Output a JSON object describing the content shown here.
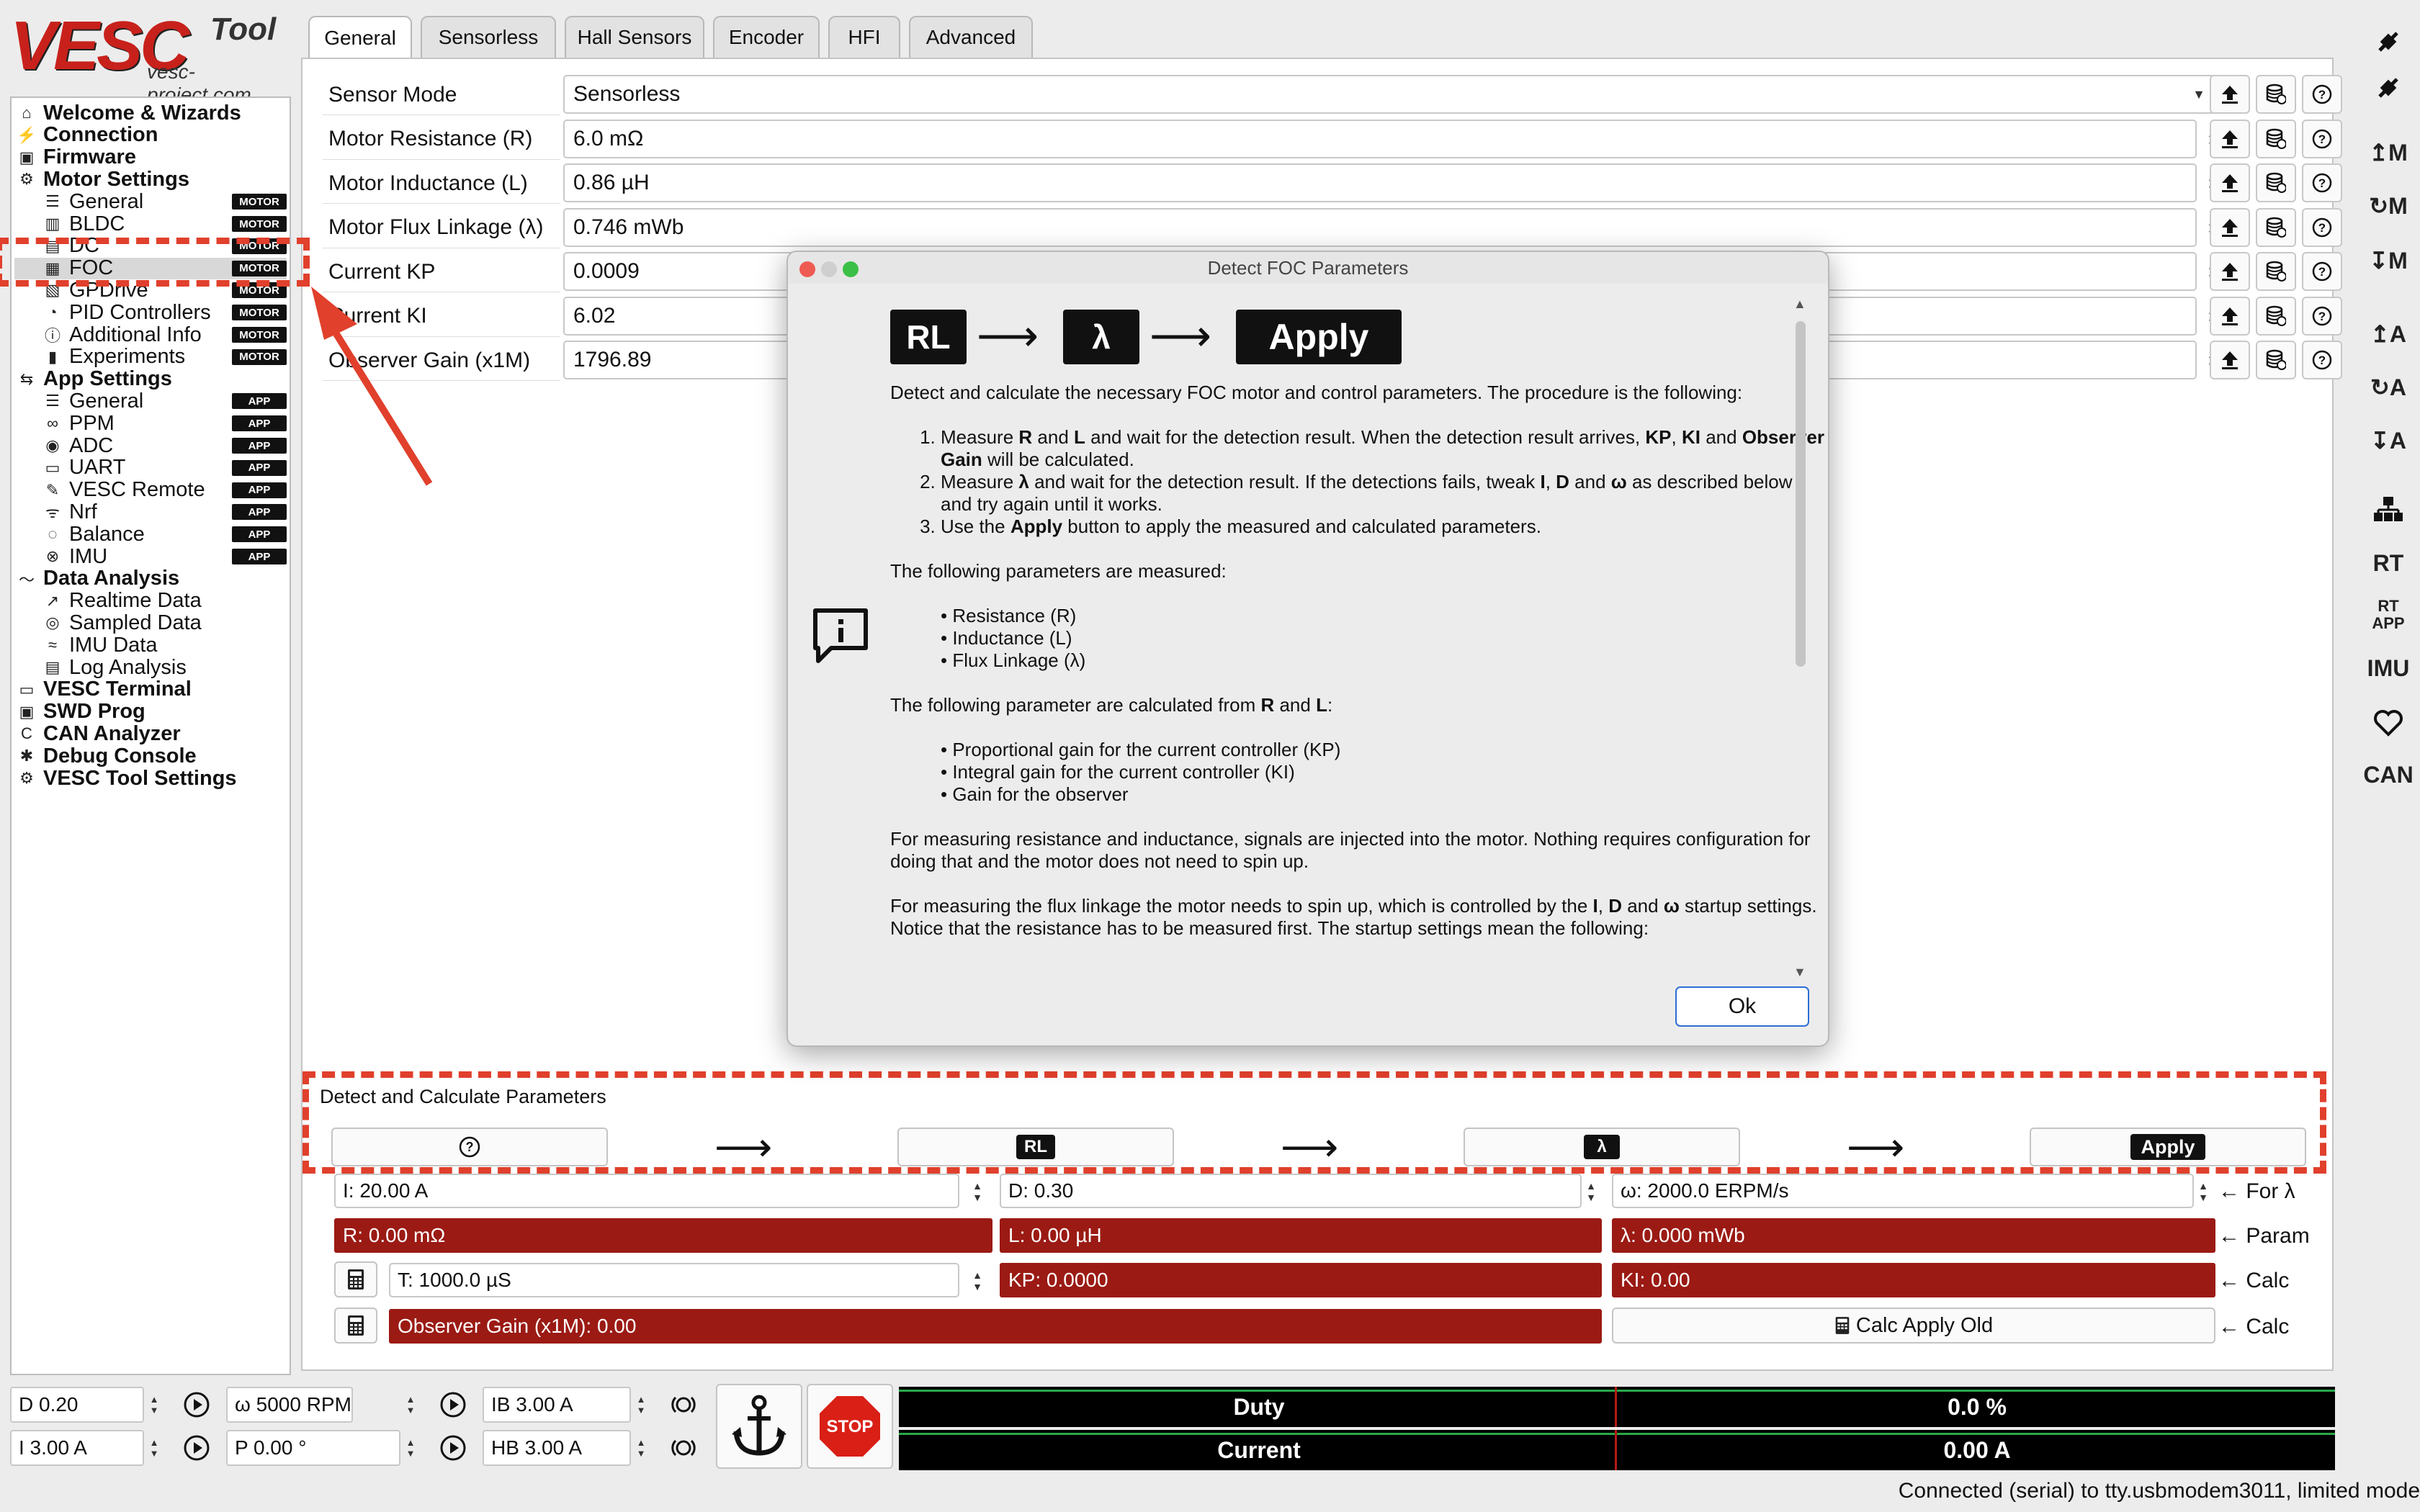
{
  "logo": {
    "brand": "VESC",
    "suffix": "Tool",
    "url": "vesc-project.com"
  },
  "sidebar": {
    "items": [
      {
        "label": "Welcome & Wizards",
        "icon": "home-icon",
        "level": 1
      },
      {
        "label": "Connection",
        "icon": "plug-icon",
        "level": 1
      },
      {
        "label": "Firmware",
        "icon": "chip-icon",
        "level": 1
      },
      {
        "label": "Motor Settings",
        "icon": "motor-icon",
        "level": 1
      },
      {
        "label": "General",
        "icon": "sliders-icon",
        "level": 2,
        "badge": "MOTOR"
      },
      {
        "label": "BLDC",
        "icon": "bldc-icon",
        "level": 2,
        "badge": "MOTOR"
      },
      {
        "label": "DC",
        "icon": "dc-icon",
        "level": 2,
        "badge": "MOTOR"
      },
      {
        "label": "FOC",
        "icon": "foc-icon",
        "level": 2,
        "badge": "MOTOR",
        "selected": true
      },
      {
        "label": "GPDrive",
        "icon": "gpdrive-icon",
        "level": 2,
        "badge": "MOTOR"
      },
      {
        "label": "PID Controllers",
        "icon": "gauge-icon",
        "level": 2,
        "badge": "MOTOR"
      },
      {
        "label": "Additional Info",
        "icon": "info-icon",
        "level": 2,
        "badge": "MOTOR"
      },
      {
        "label": "Experiments",
        "icon": "flask-icon",
        "level": 2,
        "badge": "MOTOR"
      },
      {
        "label": "App Settings",
        "icon": "swap-icon",
        "level": 1
      },
      {
        "label": "General",
        "icon": "sliders-icon",
        "level": 2,
        "badge": "APP"
      },
      {
        "label": "PPM",
        "icon": "ppm-icon",
        "level": 2,
        "badge": "APP"
      },
      {
        "label": "ADC",
        "icon": "adc-icon",
        "level": 2,
        "badge": "APP"
      },
      {
        "label": "UART",
        "icon": "uart-icon",
        "level": 2,
        "badge": "APP"
      },
      {
        "label": "VESC Remote",
        "icon": "remote-icon",
        "level": 2,
        "badge": "APP"
      },
      {
        "label": "Nrf",
        "icon": "wireless-icon",
        "level": 2,
        "badge": "APP"
      },
      {
        "label": "Balance",
        "icon": "balance-icon",
        "level": 2,
        "badge": "APP"
      },
      {
        "label": "IMU",
        "icon": "imu-icon",
        "level": 2,
        "badge": "APP"
      },
      {
        "label": "Data Analysis",
        "icon": "chart-icon",
        "level": 1
      },
      {
        "label": "Realtime Data",
        "icon": "realtime-icon",
        "level": 2
      },
      {
        "label": "Sampled Data",
        "icon": "sampled-icon",
        "level": 2
      },
      {
        "label": "IMU Data",
        "icon": "imu-data-icon",
        "level": 2
      },
      {
        "label": "Log Analysis",
        "icon": "log-icon",
        "level": 2
      },
      {
        "label": "VESC Terminal",
        "icon": "terminal-icon",
        "level": 1
      },
      {
        "label": "SWD Prog",
        "icon": "chip-icon",
        "level": 1
      },
      {
        "label": "CAN Analyzer",
        "icon": "can-icon",
        "level": 1
      },
      {
        "label": "Debug Console",
        "icon": "bug-icon",
        "level": 1
      },
      {
        "label": "VESC Tool Settings",
        "icon": "gear-icon",
        "level": 1
      }
    ]
  },
  "tabs": [
    "General",
    "Sensorless",
    "Hall Sensors",
    "Encoder",
    "HFI",
    "Advanced"
  ],
  "params": [
    {
      "label": "Sensor Mode",
      "value": "Sensorless",
      "type": "select"
    },
    {
      "label": "Motor Resistance (R)",
      "value": "6.0 mΩ",
      "type": "spin"
    },
    {
      "label": "Motor Inductance (L)",
      "value": "0.86 µH",
      "type": "spin"
    },
    {
      "label": "Motor Flux Linkage (λ)",
      "value": "0.746 mWb",
      "type": "spin"
    },
    {
      "label": "Current KP",
      "value": "0.0009",
      "type": "spin"
    },
    {
      "label": "Current KI",
      "value": "6.02",
      "type": "spin"
    },
    {
      "label": "Observer Gain (x1M)",
      "value": "1796.89",
      "type": "spin"
    }
  ],
  "detect": {
    "title": "Detect and Calculate Parameters",
    "help_icon": "?",
    "rl_label": "RL",
    "lambda_label": "λ",
    "apply_label": "Apply",
    "i_field": "I: 20.00 A",
    "d_field": "D: 0.30",
    "w_field": "ω: 2000.0 ERPM/s",
    "for_lambda": "← For λ",
    "r_result": "R: 0.00 mΩ",
    "l_result": "L: 0.00 µH",
    "lambda_result": "λ: 0.000 mWb",
    "param_label": "← Param",
    "t_field": "T: 1000.0 µS",
    "kp_result": "KP: 0.0000",
    "ki_result": "KI: 0.00",
    "calc_label": "← Calc",
    "observer_result": "Observer Gain (x1M): 0.00",
    "calc_apply_old": "Calc Apply Old",
    "calc_label2": "← Calc"
  },
  "dialog": {
    "title": "Detect FOC Parameters",
    "header_rl": "RL",
    "header_lambda": "λ",
    "header_apply": "Apply",
    "intro": "Detect and calculate the necessary FOC motor and control parameters. The procedure is the following:",
    "steps": [
      "Measure R and L and wait for the detection result. When the detection result arrives, KP, KI and Observer Gain will be calculated.",
      "Measure λ and wait for the detection result. If the detections fails, tweak I, D and ω as described below and try again until it works.",
      "Use the Apply button to apply the measured and calculated parameters."
    ],
    "measured_title": "The following parameters are measured:",
    "measured": [
      "Resistance (R)",
      "Inductance (L)",
      "Flux Linkage (λ)"
    ],
    "calculated_title": "The following parameter are calculated from R and L:",
    "calculated": [
      "Proportional gain for the current controller (KP)",
      "Integral gain for the current controller (KI)",
      "Gain for the observer"
    ],
    "para_rl": "For measuring resistance and inductance, signals are injected into the motor. Nothing requires configuration for doing that and the motor does not need to spin up.",
    "para_flux": "For measuring the flux linkage the motor needs to spin up, which is controlled by the I, D and ω startup settings. Notice that the resistance has to be measured first. The startup settings mean the following:",
    "ok": "Ok"
  },
  "right_toolbar": [
    {
      "icon": "connect-icon",
      "text": ""
    },
    {
      "icon": "disconnect-icon",
      "text": ""
    },
    {
      "icon": "read-motor-icon",
      "text": "↥M"
    },
    {
      "icon": "read-default-motor-icon",
      "text": "↻M"
    },
    {
      "icon": "write-motor-icon",
      "text": "↧M"
    },
    {
      "icon": "read-app-icon",
      "text": "↥A"
    },
    {
      "icon": "read-default-app-icon",
      "text": "↻A"
    },
    {
      "icon": "write-app-icon",
      "text": "↧A"
    },
    {
      "icon": "can-devices-icon",
      "text": ""
    },
    {
      "icon": "rt-data-icon",
      "text": "RT"
    },
    {
      "icon": "rt-app-icon",
      "text": "RT APP"
    },
    {
      "icon": "imu-stream-icon",
      "text": "IMU"
    },
    {
      "icon": "keepalive-icon",
      "text": ""
    },
    {
      "icon": "can-fwd-icon",
      "text": "CAN"
    }
  ],
  "bottom": {
    "duty": "D 0.20",
    "speed": "ω 5000 RPM",
    "brake": "IB 3.00 A",
    "current": "I 3.00 A",
    "position": "P 0.00 °",
    "handbrake": "HB 3.00 A",
    "stop": "STOP",
    "gauges": [
      {
        "label": "Duty",
        "value": "0.0 %"
      },
      {
        "label": "Current",
        "value": "0.00 A"
      }
    ]
  },
  "status": "Connected (serial) to tty.usbmodem3011, limited mode",
  "colors": {
    "accent_red": "#9b1a14",
    "callout": "#e0402c",
    "ok_border": "#2b6fd6"
  }
}
